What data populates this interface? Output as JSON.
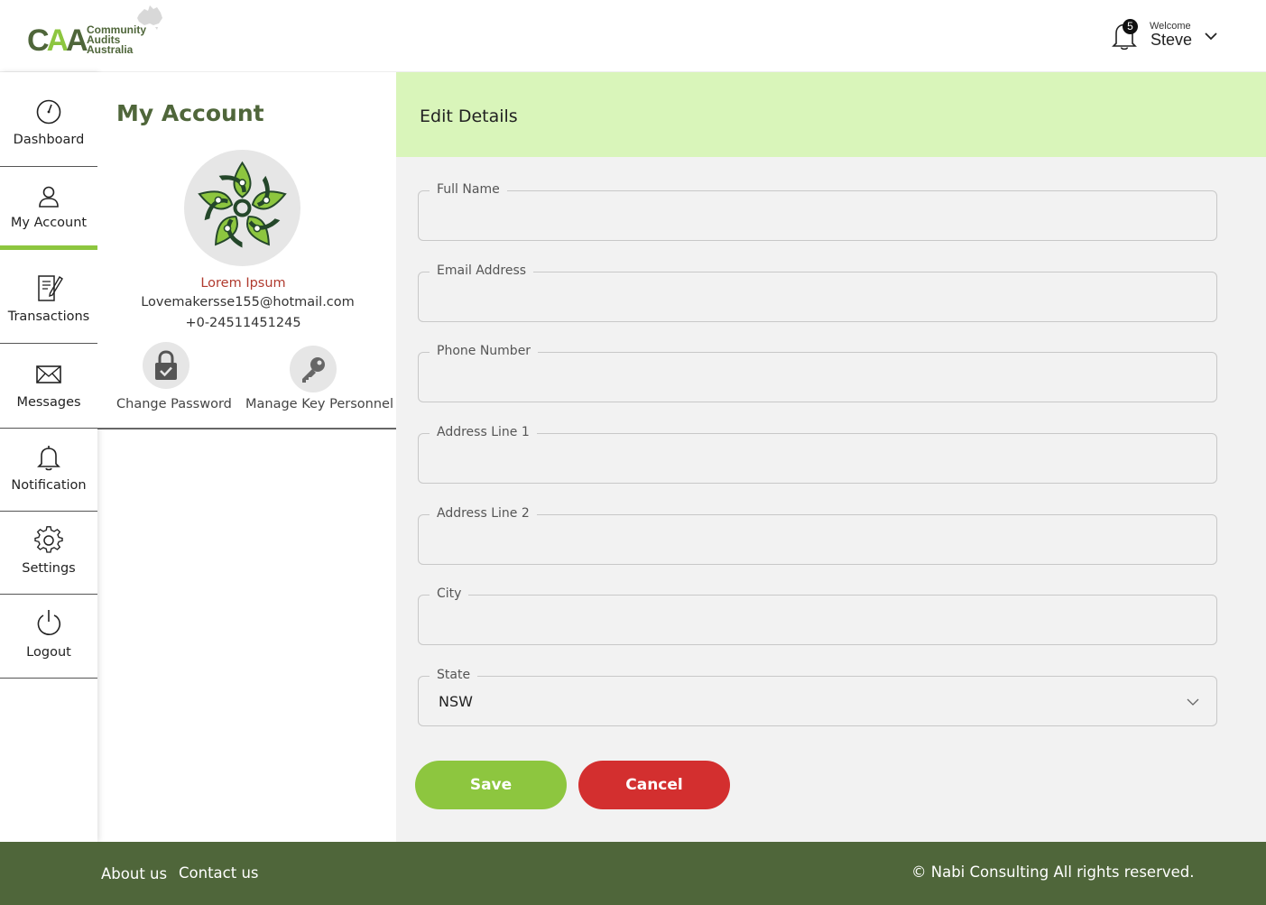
{
  "header": {
    "logo_text": "CAA",
    "logo_lines": [
      "Community",
      "Audits",
      "Australia"
    ],
    "notification_count": "5",
    "welcome_label": "Welcome",
    "user_name": "Steve"
  },
  "sidebar": {
    "items": [
      {
        "label": "Dashboard",
        "icon": "speedometer-icon"
      },
      {
        "label": "My Account",
        "icon": "user-icon",
        "active": true
      },
      {
        "label": "Transactions",
        "icon": "document-pen-icon"
      },
      {
        "label": "Messages",
        "icon": "envelope-icon"
      },
      {
        "label": "Notification",
        "icon": "bell-icon"
      },
      {
        "label": "Settings",
        "icon": "gear-icon"
      },
      {
        "label": "Logout",
        "icon": "power-icon"
      }
    ]
  },
  "account": {
    "title": "My Account",
    "name": "Lorem Ipsum",
    "email": "Lovemakersse155@hotmail.com",
    "phone": "+0-24511451245",
    "actions": [
      {
        "label": "Change Password",
        "icon": "lock-icon"
      },
      {
        "label": "Manage Key Personnel",
        "icon": "key-icon"
      }
    ]
  },
  "edit": {
    "title": "Edit Details",
    "fields": [
      {
        "label": "Full Name",
        "value": ""
      },
      {
        "label": "Email Address",
        "value": ""
      },
      {
        "label": "Phone Number",
        "value": ""
      },
      {
        "label": "Address Line 1",
        "value": ""
      },
      {
        "label": "Address Line 2",
        "value": ""
      },
      {
        "label": "City",
        "value": ""
      }
    ],
    "state": {
      "label": "State",
      "value": "NSW"
    },
    "save_label": "Save",
    "cancel_label": "Cancel"
  },
  "footer": {
    "about": "About us",
    "contact": "Contact us",
    "copyright": "© Nabi Consulting All rights reserved."
  },
  "colors": {
    "brand_dark": "#4f663a",
    "brand_light": "#8dc63f",
    "header_band": "#d9f5ba",
    "cancel": "#d32f2f",
    "name_red": "#b03a2e"
  }
}
